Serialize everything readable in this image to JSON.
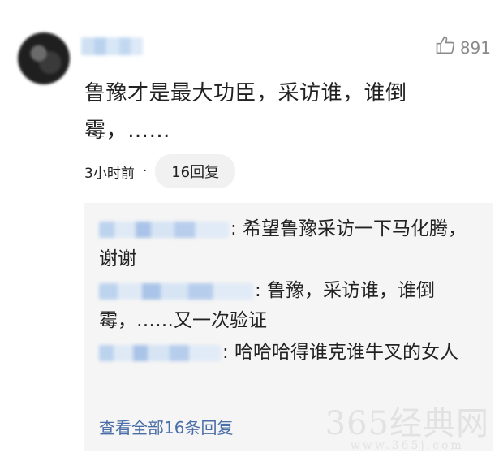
{
  "comment": {
    "likes": "891",
    "text": "鲁豫才是最大功臣，采访谁，谁倒霉，……",
    "time": "3小时前",
    "dot": "·",
    "reply_count_label": "16回复"
  },
  "replies": [
    {
      "text": ": 希望鲁豫采访一下马化腾，谢谢"
    },
    {
      "text": ": 鲁豫，采访谁，谁倒霉，……又一次验证"
    },
    {
      "text": ": 哈哈哈得谁克谁牛叉的女人"
    }
  ],
  "view_all_label": "查看全部16条回复",
  "watermark": {
    "main": "365经典网",
    "sub": "www.365j.com"
  }
}
